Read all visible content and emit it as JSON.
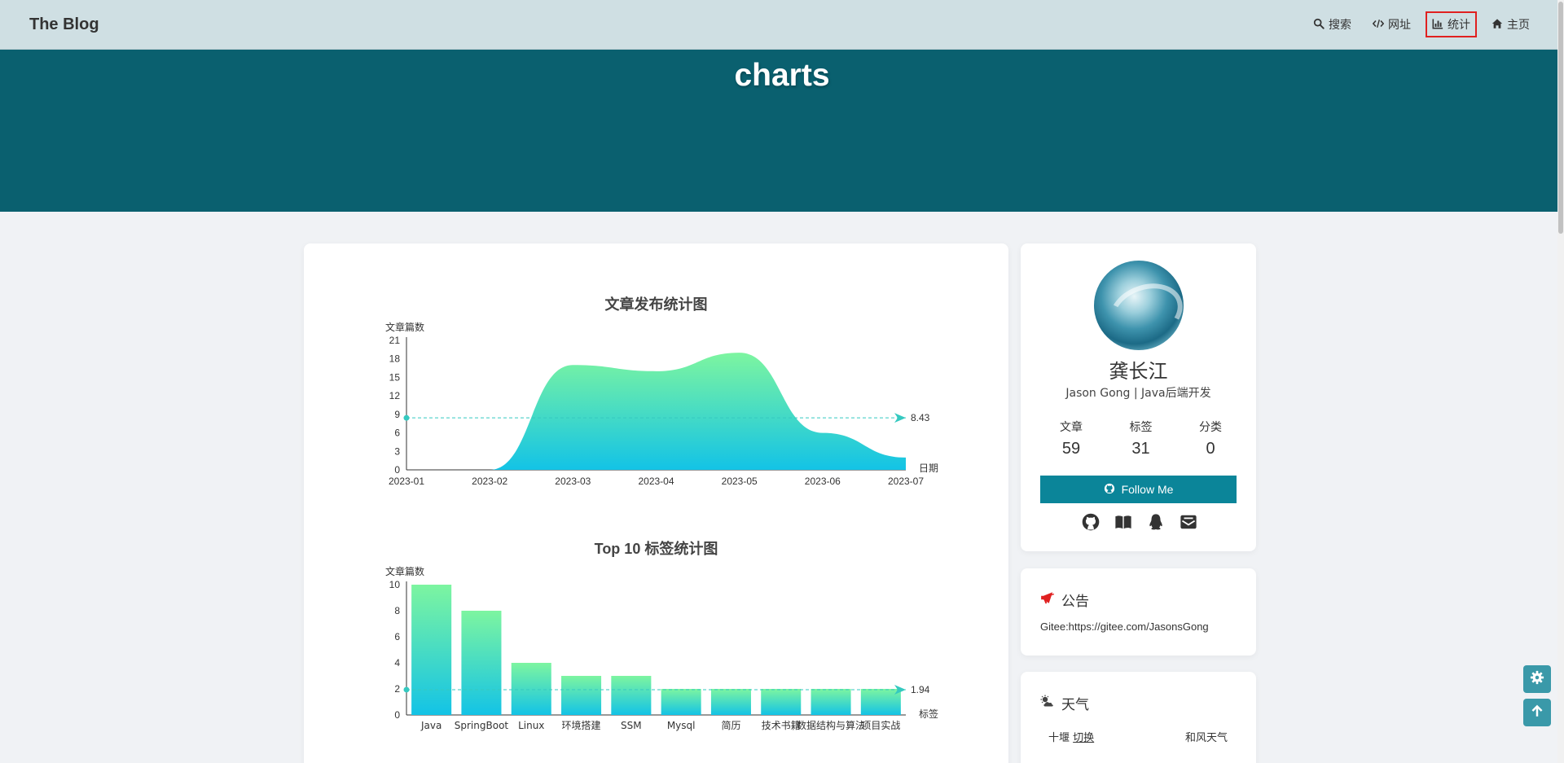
{
  "navbar": {
    "brand": "The Blog",
    "items": [
      {
        "label": "搜索",
        "icon": "search-icon"
      },
      {
        "label": "网址",
        "icon": "code-icon"
      },
      {
        "label": "统计",
        "icon": "chart-icon",
        "active": true
      },
      {
        "label": "主页",
        "icon": "home-icon"
      }
    ]
  },
  "banner": {
    "title": "charts"
  },
  "colors": {
    "navbar_bg": "#cfdfe3",
    "banner_bg": "#0a606f",
    "gradient_top": "#7df5a0",
    "gradient_bottom": "#13c3e6",
    "follow_button": "#0b8599",
    "active_outline": "#e02020"
  },
  "chart_data": [
    {
      "type": "area",
      "title": "文章发布统计图",
      "ylabel": "文章篇数",
      "xlabel": "日期",
      "categories": [
        "2023-01",
        "2023-02",
        "2023-03",
        "2023-04",
        "2023-05",
        "2023-06",
        "2023-07"
      ],
      "series": [
        {
          "values": [
            0,
            0,
            17,
            16,
            19,
            6,
            2
          ]
        }
      ],
      "ylim": [
        0,
        21
      ],
      "yticks": [
        0,
        3,
        6,
        9,
        12,
        15,
        18,
        21
      ],
      "average_line": 8.43,
      "average_label": "8.43",
      "grid": false,
      "smooth": true
    },
    {
      "type": "bar",
      "title": "Top 10 标签统计图",
      "ylabel": "文章篇数",
      "xlabel": "标签",
      "categories": [
        "Java",
        "SpringBoot",
        "Linux",
        "环境搭建",
        "SSM",
        "Mysql",
        "简历",
        "技术书籍",
        "数据结构与算法",
        "项目实战"
      ],
      "values": [
        10,
        8,
        4,
        3,
        3,
        2,
        2,
        2,
        2,
        2
      ],
      "ylim": [
        0,
        10
      ],
      "yticks": [
        0,
        2,
        4,
        6,
        8,
        10
      ],
      "average_line": 1.94,
      "average_label": "1.94",
      "grid": false
    }
  ],
  "profile": {
    "name": "龚长江",
    "description": "Jason Gong | Java后端开发",
    "stats": [
      {
        "label": "文章",
        "value": "59"
      },
      {
        "label": "标签",
        "value": "31"
      },
      {
        "label": "分类",
        "value": "0"
      }
    ],
    "follow_label": "Follow Me",
    "social_icons": [
      "github-icon",
      "book-icon",
      "qq-icon",
      "mail-icon"
    ]
  },
  "notice": {
    "title": "公告",
    "text": "Gitee:https://gitee.com/JasonsGong"
  },
  "weather": {
    "title": "天气",
    "city": "十堰",
    "switch_label": "切换",
    "provider": "和风天气"
  }
}
